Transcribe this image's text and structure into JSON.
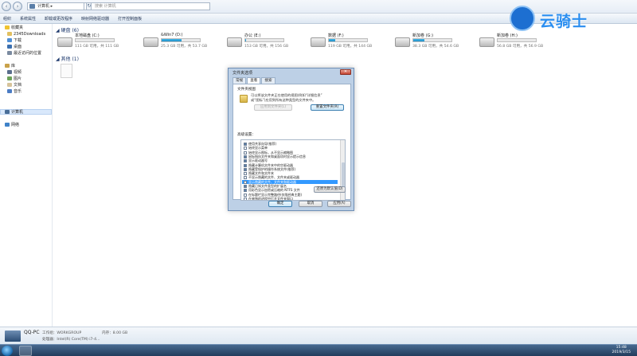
{
  "address": {
    "path": "计算机",
    "search_placeholder": "搜索 计算机"
  },
  "toolbar": {
    "items": [
      "组织",
      "系统属性",
      "卸载或更改程序",
      "映射网络驱动器",
      "打开控制面板"
    ]
  },
  "nav": {
    "favorites": "收藏夹",
    "items_fav": [
      "2345Downloads",
      "下载",
      "桌面",
      "最近访问的位置"
    ],
    "libraries": "库",
    "items_lib": [
      "视频",
      "图片",
      "文档",
      "音乐"
    ],
    "computer": "计算机",
    "network": "网络"
  },
  "groups": {
    "hard_drives": "硬盘 (6)",
    "other": "其他 (1)"
  },
  "drives": [
    {
      "name": "本地磁盘 (C:)",
      "size": "111 GB 可用，共 111 GB",
      "used": 0.0
    },
    {
      "name": "&Win7 (D:)",
      "size": "25.3 GB 可用，共 53.7 GB",
      "used": 0.53
    },
    {
      "name": "办公 (E:)",
      "size": "153 GB 可用，共 156 GB",
      "used": 0.02
    },
    {
      "name": "数据 (F:)",
      "size": "119 GB 可用，共 144 GB",
      "used": 0.17
    },
    {
      "name": "新加卷 (G:)",
      "size": "38.3 GB 可用，共 54.6 GB",
      "used": 0.3
    },
    {
      "name": "新加卷 (H:)",
      "size": "56.8 GB 可用，共 56.9 GB",
      "used": 0.0
    }
  ],
  "dialog": {
    "title": "文件夹选项",
    "tabs": [
      "常规",
      "查看",
      "搜索"
    ],
    "section_views": "文件夹视图",
    "desc1": "可以将该文件夹正在使用的视图(例如“详细信息”",
    "desc2": "或“图标”)应用到所有这种类型的文件夹中。",
    "apply_folders": "应用到文件夹(L)",
    "reset_folders": "重置文件夹(R)",
    "section_advanced": "高级设置：",
    "tree": [
      {
        "label": "使用共享向导(推荐)",
        "checked": true
      },
      {
        "label": "始终显示菜单",
        "checked": false
      },
      {
        "label": "始终显示图标，从不显示缩略图",
        "checked": false
      },
      {
        "label": "鼠标指向文件夹和桌面项时显示提示信息",
        "checked": true
      },
      {
        "label": "显示驱动器号",
        "checked": true
      },
      {
        "label": "隐藏计算机文件夹中的空驱动器",
        "checked": true
      },
      {
        "label": "隐藏受保护的操作系统文件(推荐)",
        "checked": true
      },
      {
        "label": "隐藏文件和文件夹",
        "checked": false
      },
      {
        "label": "不显示隐藏的文件、文件夹或驱动器",
        "checked": false
      },
      {
        "label": "显示隐藏的文件、文件夹和驱动器",
        "checked": false,
        "selected": true
      },
      {
        "label": "隐藏已知文件类型的扩展名",
        "checked": true
      },
      {
        "label": "用彩色显示加密或压缩的 NTFS 文件",
        "checked": true
      },
      {
        "label": "在标题栏显示完整路径(仅限经典主题)",
        "checked": false
      },
      {
        "label": "在单独的进程中打开文件夹窗口",
        "checked": false
      }
    ],
    "restore_defaults": "还原为默认值(D)",
    "ok": "确定",
    "cancel": "取消",
    "apply": "应用(A)"
  },
  "details": {
    "pc_name": "QQ-PC",
    "workgroup_label": "工作组：WORKGROUP",
    "memory_label": "内存：8.00 GB",
    "cpu_label": "处理器：Intel(R) Core(TM) i7-4..."
  },
  "taskbar": {
    "time": "15:48",
    "date": "2019/3/15"
  },
  "watermark": {
    "text": "云骑士"
  }
}
